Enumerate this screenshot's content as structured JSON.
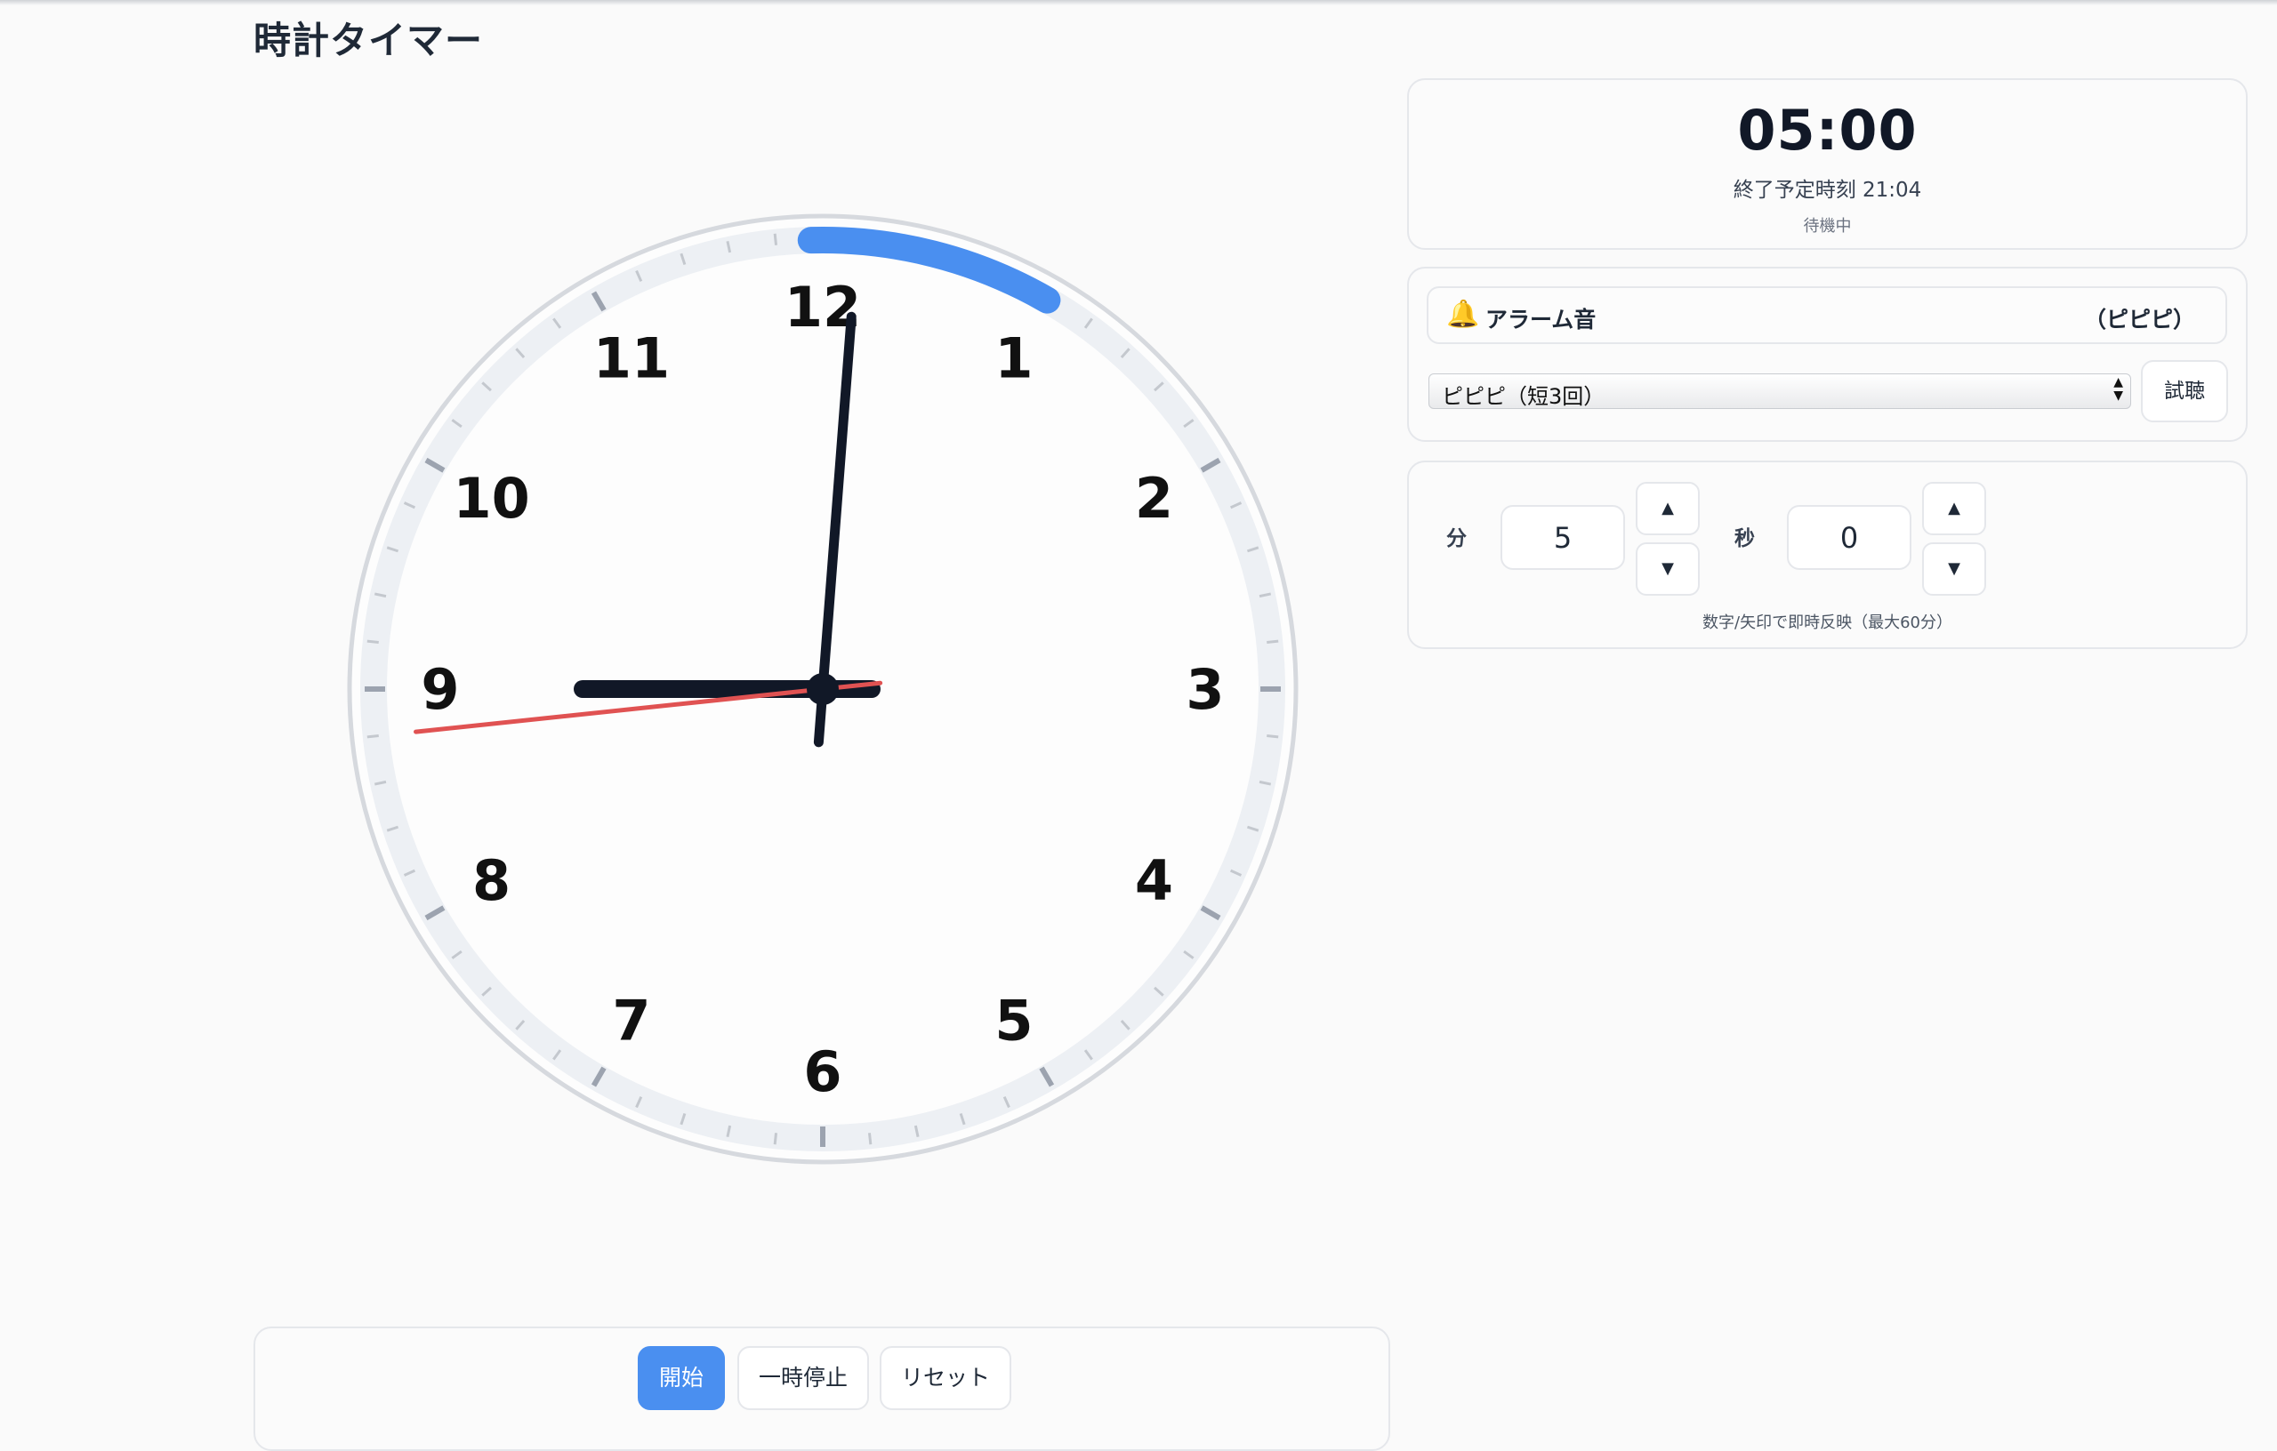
{
  "app": {
    "title": "時計タイマー"
  },
  "clock": {
    "numbers": [
      "12",
      "1",
      "2",
      "3",
      "4",
      "5",
      "6",
      "7",
      "8",
      "9",
      "10",
      "11"
    ],
    "remaining_minutes": 5,
    "remaining_fraction_of_hour": 0.0833,
    "hand_time": {
      "hour": 9,
      "minute": 0,
      "second": 44
    },
    "colors": {
      "progress": "#4a8ff0",
      "hands": "#111827",
      "second_hand": "#e05252",
      "ring": "#e8ebf0"
    }
  },
  "timer": {
    "display": "05:00",
    "end_label": "終了予定時刻",
    "end_time": "21:04",
    "status": "待機中"
  },
  "alarm": {
    "icon": "bell-icon",
    "label": "アラーム音",
    "current": "（ピピピ）",
    "selected_option": "ピピピ（短3回）",
    "preview_label": "試聴"
  },
  "input": {
    "minutes_label": "分",
    "minutes_value": "5",
    "seconds_label": "秒",
    "seconds_value": "0",
    "up_symbol": "▲",
    "down_symbol": "▼",
    "hint": "数字/矢印で即時反映（最大60分）"
  },
  "controls": {
    "start_label": "開始",
    "pause_label": "一時停止",
    "reset_label": "リセット"
  }
}
